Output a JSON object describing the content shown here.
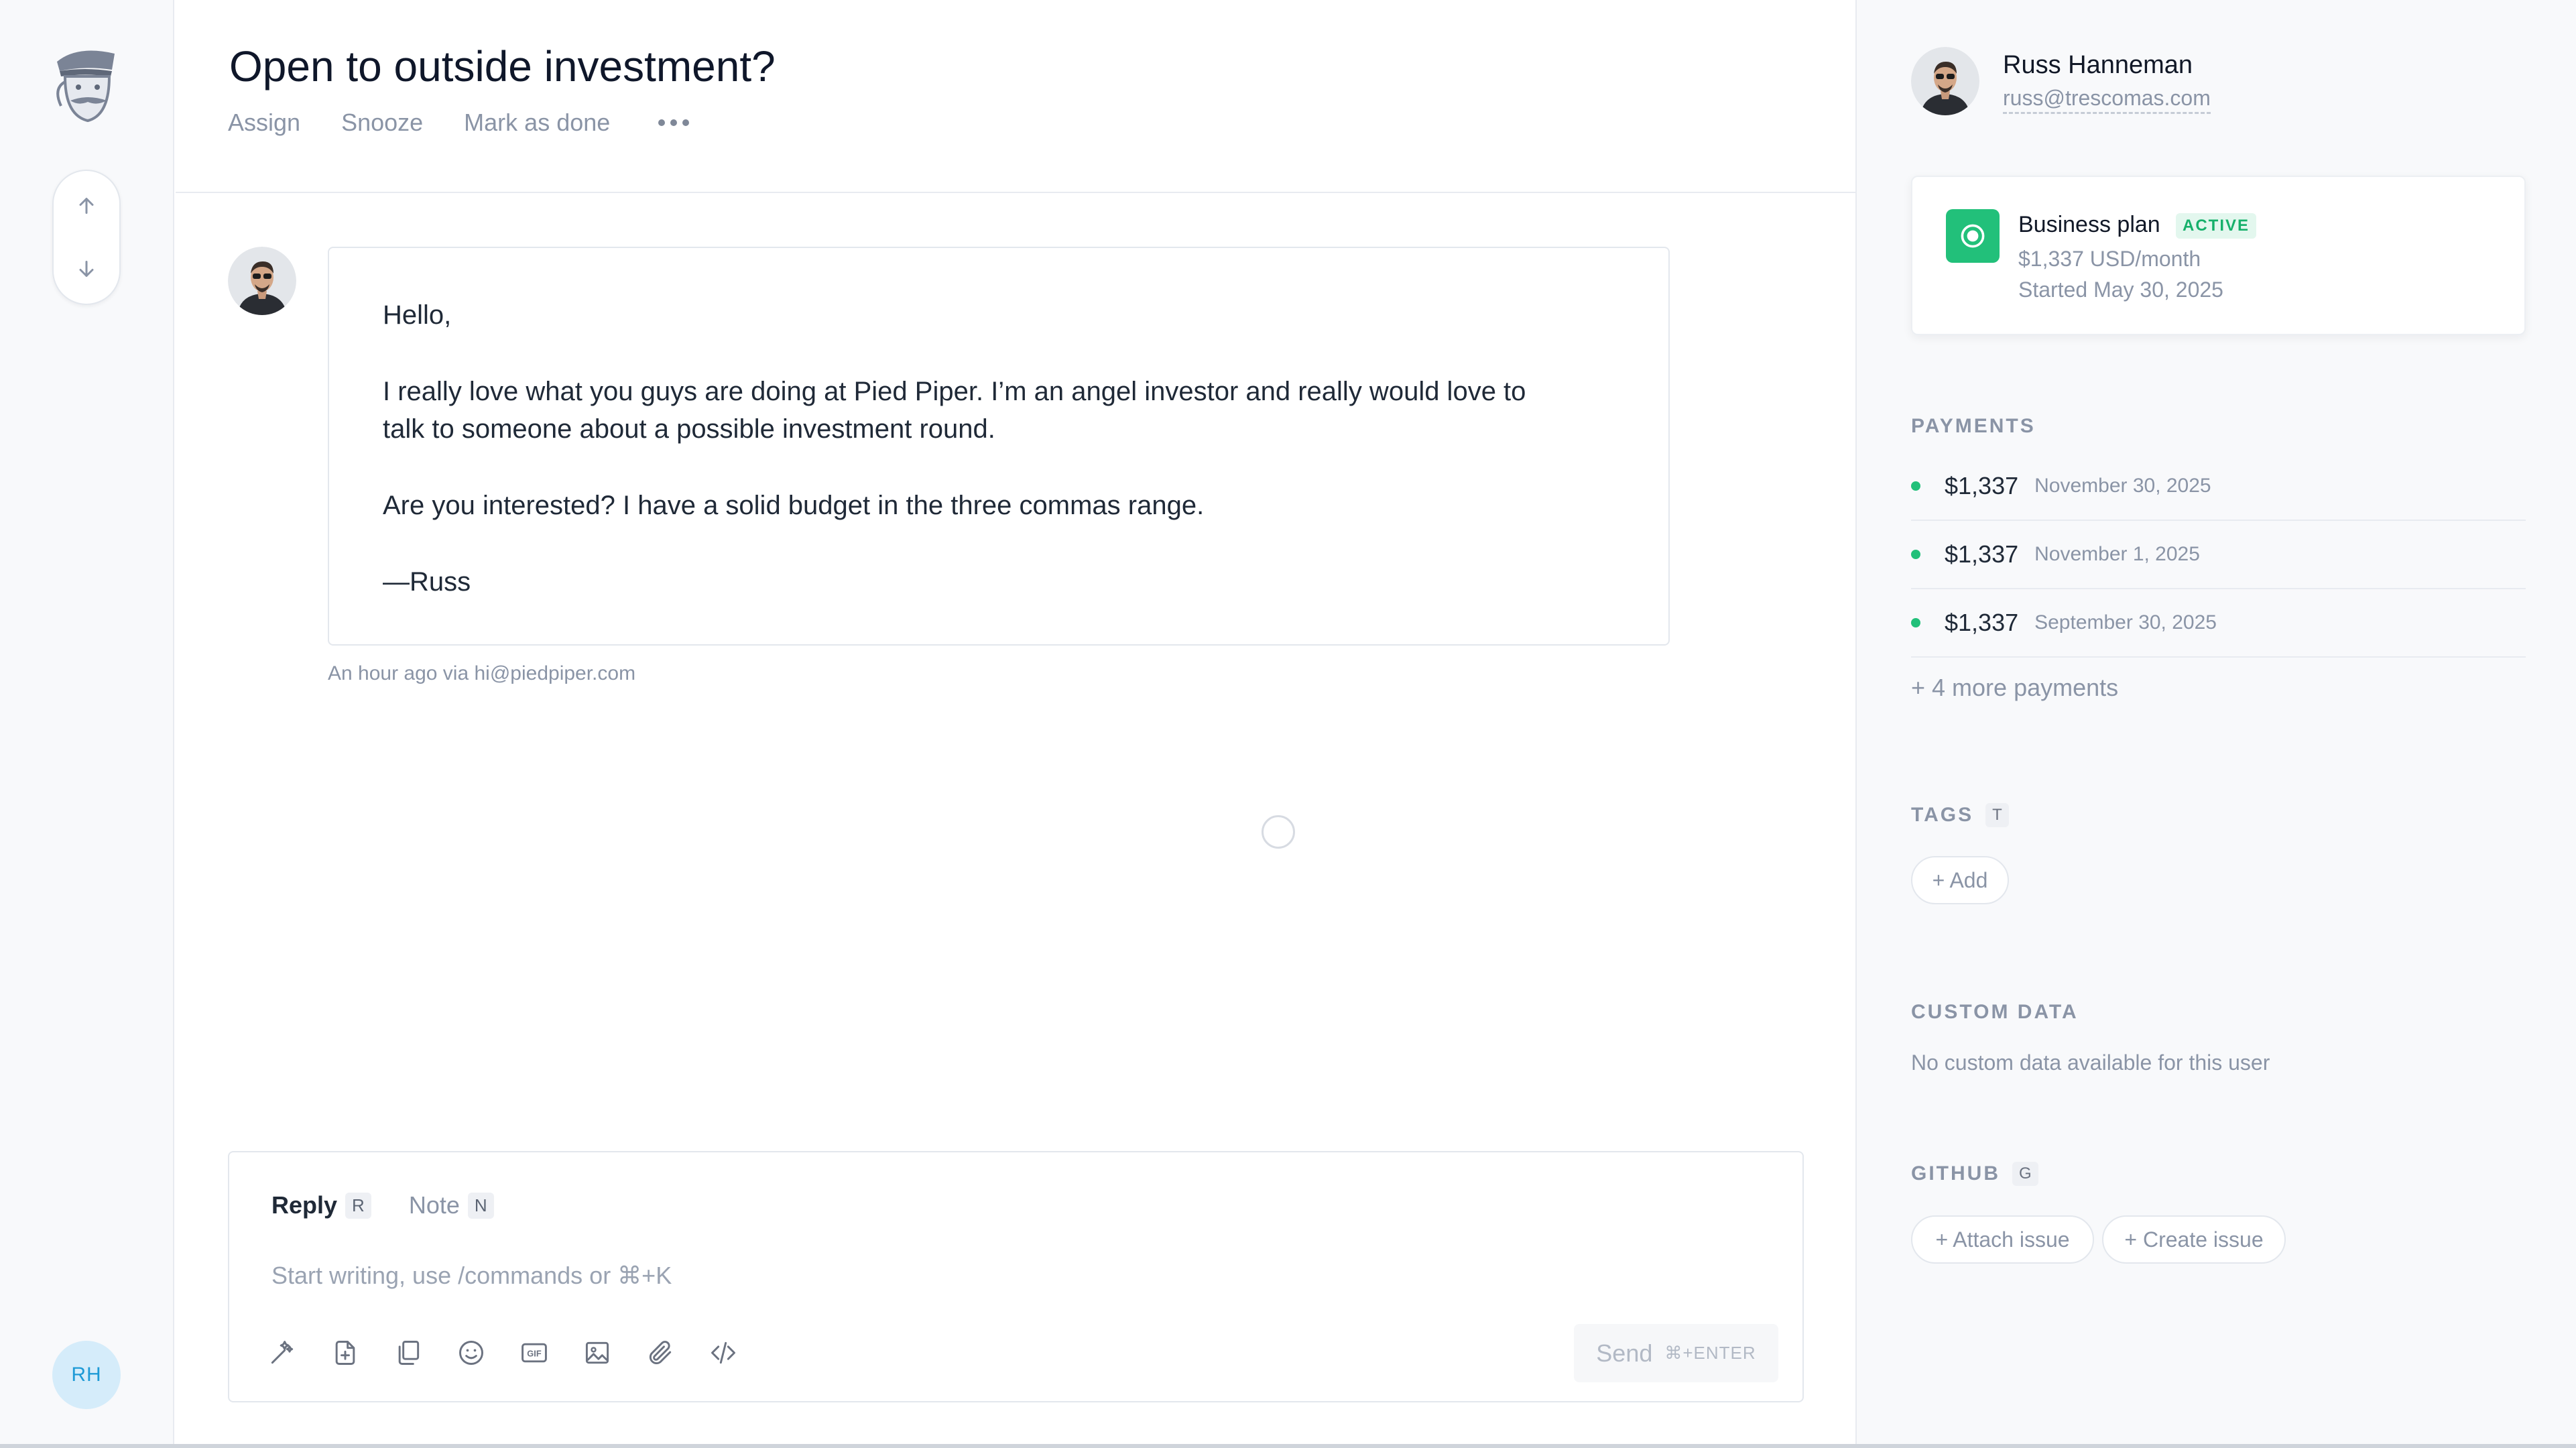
{
  "conversation": {
    "title": "Open to outside investment?",
    "actions": [
      "Assign",
      "Snooze",
      "Mark as done"
    ],
    "more_icon": "more-horizontal-icon"
  },
  "message": {
    "greeting": "Hello,",
    "body_line1": "I really love what you guys are doing at Pied Piper. I’m an angel investor and really would love to",
    "body_line2": "talk to someone about a possible investment round.",
    "body_line3": "Are you interested? I have a solid budget in the three commas range.",
    "signature": "—Russ",
    "meta": "An hour ago via hi@piedpiper.com"
  },
  "composer": {
    "tabs": [
      {
        "label": "Reply",
        "shortcut": "R"
      },
      {
        "label": "Note",
        "shortcut": "N"
      }
    ],
    "placeholder": "Start writing, use /commands or ⌘+K",
    "send_label": "Send",
    "send_hint": "⌘+ENTER",
    "tools": [
      "magic-wand-icon",
      "add-document-icon",
      "copy-icon",
      "emoji-icon",
      "gif-icon",
      "image-icon",
      "paperclip-icon",
      "code-icon"
    ]
  },
  "rail": {
    "user_initials": "RH",
    "icons": [
      "logo-icon",
      "arrow-up-icon",
      "arrow-down-icon"
    ]
  },
  "contact": {
    "name": "Russ Hanneman",
    "email": "russ@trescomas.com"
  },
  "subscription": {
    "plan": "Business plan",
    "status": "ACTIVE",
    "price": "$1,337 USD/month",
    "started": "Started May 30, 2025"
  },
  "payments": {
    "label": "PAYMENTS",
    "items": [
      {
        "amount": "$1,337",
        "date": "November 30, 2025"
      },
      {
        "amount": "$1,337",
        "date": "November 1, 2025"
      },
      {
        "amount": "$1,337",
        "date": "September 30, 2025"
      }
    ],
    "more": "+ 4 more payments"
  },
  "tags": {
    "label": "TAGS",
    "shortcut": "T",
    "add": "+ Add"
  },
  "custom_data": {
    "label": "CUSTOM DATA",
    "empty": "No custom data available for this user"
  },
  "github": {
    "label": "GITHUB",
    "shortcut": "G",
    "attach": "+ Attach issue",
    "create": "+ Create issue"
  },
  "colors": {
    "accent_green": "#22c07a",
    "avatar_blue": "#1e9ad6",
    "text_muted": "#8a94a6"
  }
}
